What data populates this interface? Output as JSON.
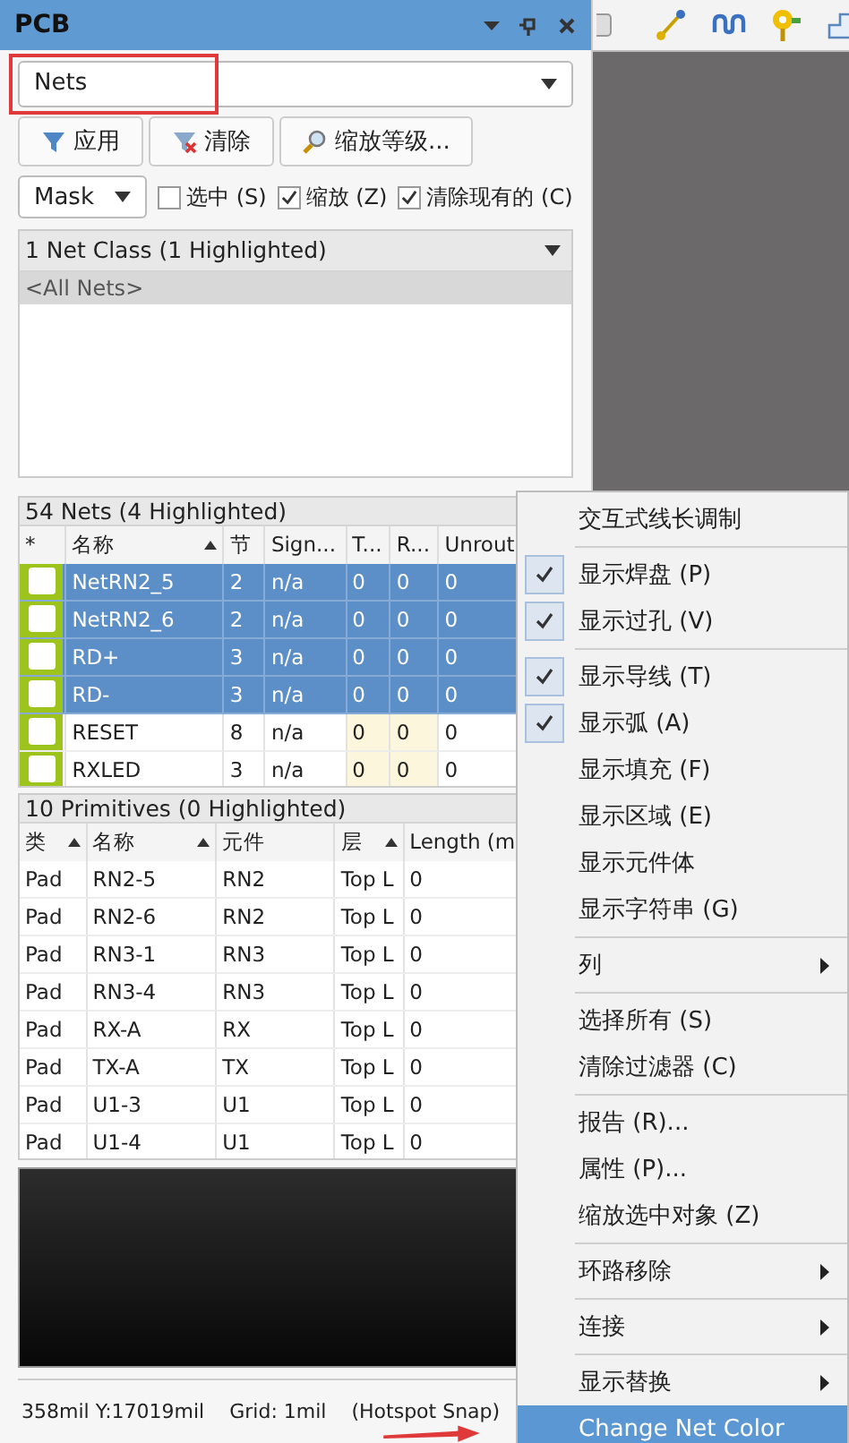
{
  "panel": {
    "title": "PCB"
  },
  "mode_select": {
    "value": "Nets"
  },
  "buttons": [
    {
      "label": "应用",
      "kind": "apply"
    },
    {
      "label": "清除",
      "kind": "clear"
    },
    {
      "label": "缩放等级...",
      "kind": "zoom"
    }
  ],
  "mask_select": {
    "value": "Mask"
  },
  "options": [
    {
      "label": "选中 (S)",
      "checked": false
    },
    {
      "label": "缩放 (Z)",
      "checked": true
    },
    {
      "label": "清除现有的 (C)",
      "checked": true
    }
  ],
  "net_classes": {
    "header": "1 Net Class (1 Highlighted)",
    "rows": [
      {
        "name": "<All Nets>",
        "selected": true
      }
    ]
  },
  "nets": {
    "header": "54 Nets (4 Highlighted)",
    "columns": [
      {
        "label": "*",
        "sorted": false
      },
      {
        "label": "名称",
        "sorted": true
      },
      {
        "label": "节",
        "sorted": false
      },
      {
        "label": "Sign...",
        "sorted": false
      },
      {
        "label": "T...",
        "sorted": false
      },
      {
        "label": "R...",
        "sorted": false
      },
      {
        "label": "Unrout"
      }
    ],
    "rows": [
      {
        "cells": [
          "",
          "NetRN2_5",
          "2",
          "n/a",
          "0",
          "0",
          "0"
        ],
        "color": "#9dc41c",
        "selected": true
      },
      {
        "cells": [
          "",
          "NetRN2_6",
          "2",
          "n/a",
          "0",
          "0",
          "0"
        ],
        "color": "#9dc41c",
        "selected": true
      },
      {
        "cells": [
          "",
          "RD+",
          "3",
          "n/a",
          "0",
          "0",
          "0"
        ],
        "color": "#9dc41c",
        "selected": true
      },
      {
        "cells": [
          "",
          "RD-",
          "3",
          "n/a",
          "0",
          "0",
          "0"
        ],
        "color": "#9dc41c",
        "selected": true
      },
      {
        "cells": [
          "",
          "RESET",
          "8",
          "n/a",
          "0",
          "0",
          "0"
        ],
        "color": "#9dc41c",
        "selected": false
      },
      {
        "cells": [
          "",
          "RXLED",
          "3",
          "n/a",
          "0",
          "0",
          "0"
        ],
        "color": "#9dc41c",
        "selected": false
      }
    ]
  },
  "primitives": {
    "header": "10 Primitives (0 Highlighted)",
    "columns": [
      {
        "label": "类",
        "sorted": true
      },
      {
        "label": "名称",
        "sorted": true
      },
      {
        "label": "元件",
        "sorted": false
      },
      {
        "label": "层",
        "sorted": true
      },
      {
        "label": "Length (m"
      }
    ],
    "rows": [
      {
        "cells": [
          "Pad",
          "RN2-5",
          "RN2",
          "Top L",
          "0"
        ],
        "selected": false
      },
      {
        "cells": [
          "Pad",
          "RN2-6",
          "RN2",
          "Top L",
          "0"
        ],
        "selected": false
      },
      {
        "cells": [
          "Pad",
          "RN3-1",
          "RN3",
          "Top L",
          "0"
        ],
        "selected": false
      },
      {
        "cells": [
          "Pad",
          "RN3-4",
          "RN3",
          "Top L",
          "0"
        ],
        "selected": false
      },
      {
        "cells": [
          "Pad",
          "RX-A",
          "RX",
          "Top L",
          "0"
        ],
        "selected": false
      },
      {
        "cells": [
          "Pad",
          "TX-A",
          "TX",
          "Top L",
          "0"
        ],
        "selected": false
      },
      {
        "cells": [
          "Pad",
          "U1-3",
          "U1",
          "Top L",
          "0"
        ],
        "selected": false
      },
      {
        "cells": [
          "Pad",
          "U1-4",
          "U1",
          "Top L",
          "0"
        ],
        "selected": false
      }
    ]
  },
  "status_bar": {
    "position": "358mil Y:17019mil",
    "grid": "Grid: 1mil",
    "snap": "(Hotspot Snap)"
  },
  "context_menu": {
    "items": [
      {
        "kind": "item",
        "label": "交互式线长调制",
        "selected": false
      },
      {
        "kind": "separator"
      },
      {
        "kind": "check",
        "label": "显示焊盘 (P)",
        "checked": true,
        "selected": false
      },
      {
        "kind": "check",
        "label": "显示过孔 (V)",
        "checked": true,
        "selected": false
      },
      {
        "kind": "separator"
      },
      {
        "kind": "check",
        "label": "显示导线 (T)",
        "checked": true,
        "selected": false
      },
      {
        "kind": "check",
        "label": "显示弧 (A)",
        "checked": true,
        "selected": false
      },
      {
        "kind": "check",
        "label": "显示填充 (F)",
        "checked": false,
        "selected": false
      },
      {
        "kind": "check",
        "label": "显示区域 (E)",
        "checked": false,
        "selected": false
      },
      {
        "kind": "check",
        "label": "显示元件体",
        "checked": false,
        "selected": false
      },
      {
        "kind": "check",
        "label": "显示字符串 (G)",
        "checked": false,
        "selected": false
      },
      {
        "kind": "separator"
      },
      {
        "kind": "submenu",
        "label": "列",
        "selected": false
      },
      {
        "kind": "separator"
      },
      {
        "kind": "item",
        "label": "选择所有 (S)",
        "selected": false
      },
      {
        "kind": "item",
        "label": "清除过滤器 (C)",
        "selected": false
      },
      {
        "kind": "separator"
      },
      {
        "kind": "item",
        "label": "报告 (R)...",
        "selected": false
      },
      {
        "kind": "item",
        "label": "属性 (P)...",
        "selected": false
      },
      {
        "kind": "item",
        "label": "缩放选中对象 (Z)",
        "selected": false
      },
      {
        "kind": "separator"
      },
      {
        "kind": "submenu",
        "label": "环路移除",
        "selected": false
      },
      {
        "kind": "separator"
      },
      {
        "kind": "submenu",
        "label": "连接",
        "selected": false
      },
      {
        "kind": "separator"
      },
      {
        "kind": "submenu",
        "label": "显示替换",
        "selected": false
      },
      {
        "kind": "item",
        "label": "Change Net Color",
        "selected": true
      }
    ]
  }
}
